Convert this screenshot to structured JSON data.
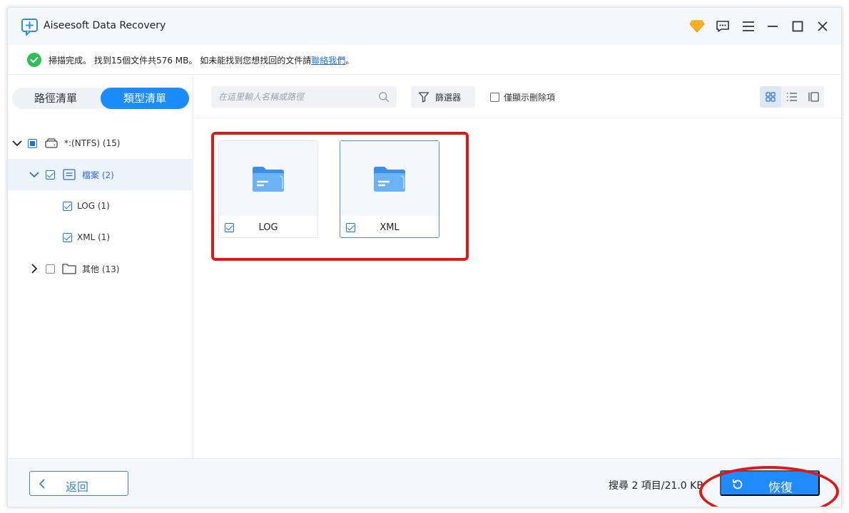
{
  "app": {
    "title": "Aiseesoft Data Recovery"
  },
  "status": {
    "message": "掃描完成。 找到15個文件共576 MB。 如未能找到您想找回的文件請",
    "link_text": "聯絡我們",
    "tail": "。"
  },
  "sidebar": {
    "tabs": [
      "路徑清單",
      "類型清單"
    ],
    "active_tab": "類型清單",
    "tree": [
      {
        "label": "*:(NTFS) (15)",
        "expanded": true,
        "check": "partial"
      },
      {
        "label": "檔案 (2)",
        "expanded": true,
        "check": "checked",
        "selected": true
      },
      {
        "label": "LOG (1)",
        "check": "checked"
      },
      {
        "label": "XML (1)",
        "check": "checked"
      },
      {
        "label": "其他 (13)",
        "expanded": false,
        "check": "unchecked"
      }
    ]
  },
  "toolbar": {
    "search_placeholder": "在這里輸人名稱或路徑",
    "filter_label": "篩選器",
    "deleted_only_label": "僅顯示刪除項"
  },
  "grid": {
    "items": [
      {
        "label": "LOG",
        "checked": true,
        "icon": "folder-icon"
      },
      {
        "label": "XML",
        "checked": true,
        "icon": "folder-icon",
        "selected": true
      }
    ]
  },
  "footer": {
    "back_label": "返回",
    "summary": "搜尋 2 項目/21.0 KB",
    "recover_label": "恢復"
  },
  "colors": {
    "accent": "#1f8bff",
    "success": "#2fbf55",
    "annotation": "#e01717"
  }
}
